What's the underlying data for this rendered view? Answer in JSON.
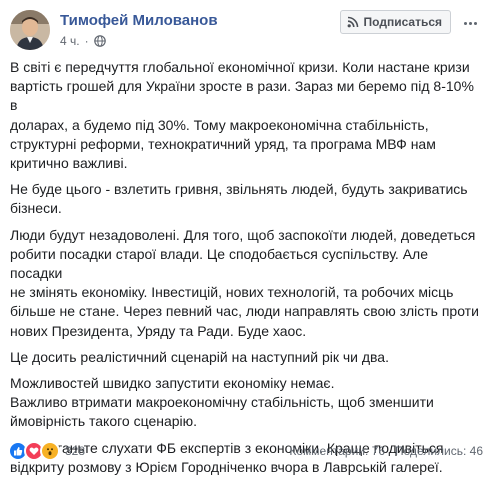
{
  "author": {
    "name": "Тимофей Милованов",
    "time": "4 ч.",
    "privacy_icon": "globe-icon"
  },
  "actions": {
    "subscribe_label": "Подписаться",
    "subscribe_icon": "rss-icon",
    "more_icon": "more-options-icon"
  },
  "paragraphs": [
    "В світі є передчуття глобальної економічної кризи. Коли настане кризи\nвартість грошей для України зросте в рази. Зараз ми беремо під 8-10% в\nдоларах, а будемо під 30%. Тому макроекономічна стабільність,\nструктурні реформи, технократичний уряд, та програма МВФ нам\nкритично важливі.",
    "Не буде цього - взлетить гривня, звільнять людей, будуть закриватись\nбізнеси.",
    "Люди будут незадоволені. Для того, щоб заспокоїти людей, доведеться\nробити посадки старої влади. Це сподобається суспільству. Але посадки\nне змінять економіку. Інвестицій, нових технологій, та робочих місць\nбільше не стане. Через певний час, люди направлять свою злість проти\nнових Президента, Уряду та Ради. Буде хаос.",
    "Це досить реалістичний сценарій на наступний рік чи два.",
    "Можливостей швидко запустити економіку немає.\nВажливо втримати макроекономічну стабільність, щоб зменшити\nймовірність такого сценарію.",
    "І перестаньте слухати ФБ експертів з економіки. Краще подивіться\nвідкриту розмову з Юрієм Городніченко вчора в Лаврській галереї."
  ],
  "footer": {
    "reaction_count": "328",
    "reactions": [
      "like-icon",
      "love-icon",
      "wow-icon"
    ],
    "comments": "Комментарии: 76",
    "shares": "Поделились: 46"
  },
  "colors": {
    "name_link": "#385898",
    "like": "#1877f2",
    "love": "#f33e58",
    "wow": "#f7b125"
  }
}
